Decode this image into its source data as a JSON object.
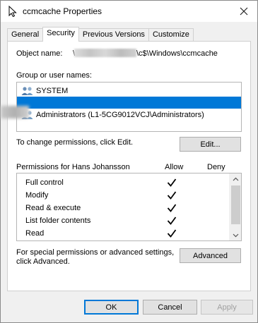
{
  "window": {
    "title": "ccmcache Properties",
    "close_icon": "close-icon"
  },
  "tabs": [
    {
      "label": "General"
    },
    {
      "label": "Security"
    },
    {
      "label": "Previous Versions"
    },
    {
      "label": "Customize"
    }
  ],
  "security": {
    "object_name_label": "Object name:",
    "object_name_prefix": "\\",
    "object_name_suffix": "\\c$\\Windows\\ccmcache",
    "group_label": "Group or user names:",
    "users": [
      {
        "name": "SYSTEM",
        "icon": "users-icon"
      },
      {
        "name": "",
        "icon": ""
      },
      {
        "name": "Administrators (L1-5CG9012VCJ\\Administrators)",
        "icon": "users-icon"
      }
    ],
    "change_hint": "To change permissions, click Edit.",
    "edit_button": "Edit...",
    "permissions_for": "Permissions for Hans Johansson",
    "allow_header": "Allow",
    "deny_header": "Deny",
    "permissions": [
      {
        "name": "Full control",
        "allow": true,
        "deny": false
      },
      {
        "name": "Modify",
        "allow": true,
        "deny": false
      },
      {
        "name": "Read & execute",
        "allow": true,
        "deny": false
      },
      {
        "name": "List folder contents",
        "allow": true,
        "deny": false
      },
      {
        "name": "Read",
        "allow": true,
        "deny": false
      }
    ],
    "advanced_hint_line1": "For special permissions or advanced settings,",
    "advanced_hint_line2": "click Advanced.",
    "advanced_button": "Advanced"
  },
  "footer": {
    "ok": "OK",
    "cancel": "Cancel",
    "apply": "Apply"
  },
  "colors": {
    "selection": "#0078d7",
    "default_button_border": "#0078d7"
  }
}
